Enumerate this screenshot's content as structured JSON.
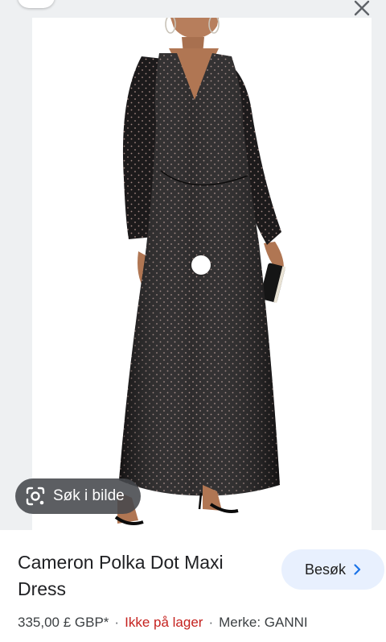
{
  "viewer": {
    "lens_button_label": "Søk i bilde",
    "product_image_alt": "Black polka dot long-sleeve maxi dress on model"
  },
  "product": {
    "title": "Cameron Polka Dot Maxi Dress",
    "visit_label": "Besøk",
    "price": "335,00 £ GBP*",
    "stock_status": "Ikke på lager",
    "separator": "·",
    "brand": "Merke: GANNI"
  },
  "icons": {
    "close": "close-icon",
    "lens": "lens-camera-icon",
    "chevron": "chevron-right-icon"
  },
  "colors": {
    "stock_out": "#c5221f",
    "visit_button_bg": "#e8f0fe",
    "dress": "#1c1a1b"
  }
}
